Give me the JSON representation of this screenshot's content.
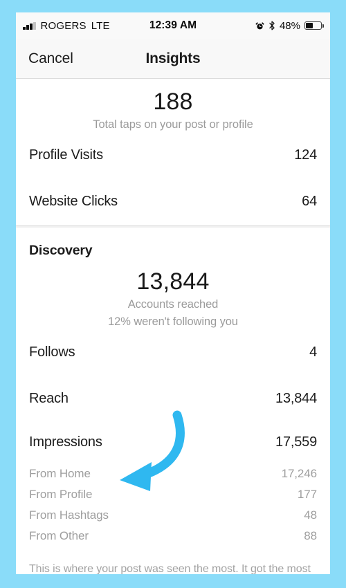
{
  "status_bar": {
    "carrier": "ROGERS",
    "network": "LTE",
    "time": "12:39 AM",
    "battery_pct": "48%",
    "icons": [
      "signal-bars-icon",
      "alarm-icon",
      "bluetooth-icon",
      "battery-icon"
    ]
  },
  "nav": {
    "cancel_label": "Cancel",
    "title": "Insights"
  },
  "interactions": {
    "hero_value": "188",
    "hero_caption": "Total taps on your post or profile",
    "rows": [
      {
        "label": "Profile Visits",
        "value": "124"
      },
      {
        "label": "Website Clicks",
        "value": "64"
      }
    ]
  },
  "discovery": {
    "section_title": "Discovery",
    "hero_value": "13,844",
    "hero_caption_line1": "Accounts reached",
    "hero_caption_line2": "12% weren't following you",
    "rows": [
      {
        "label": "Follows",
        "value": "4"
      },
      {
        "label": "Reach",
        "value": "13,844"
      }
    ],
    "impressions": {
      "label": "Impressions",
      "value": "17,559",
      "breakdown": [
        {
          "label": "From Home",
          "value": "17,246"
        },
        {
          "label": "From Profile",
          "value": "177"
        },
        {
          "label": "From Hashtags",
          "value": "48"
        },
        {
          "label": "From Other",
          "value": "88"
        }
      ]
    },
    "footnote": "This is where your post was seen the most. It got the most impressions from Home, Profile and Hashtags."
  },
  "annotation": {
    "arrow_name": "curved-arrow-annotation",
    "arrow_target": "From Hashtags",
    "arrow_color": "#2fb8f0"
  },
  "colors": {
    "frame": "#8adcf9",
    "accent": "#2fb8f0",
    "text_primary": "#1c1c1c",
    "text_muted": "#9e9e9e"
  }
}
